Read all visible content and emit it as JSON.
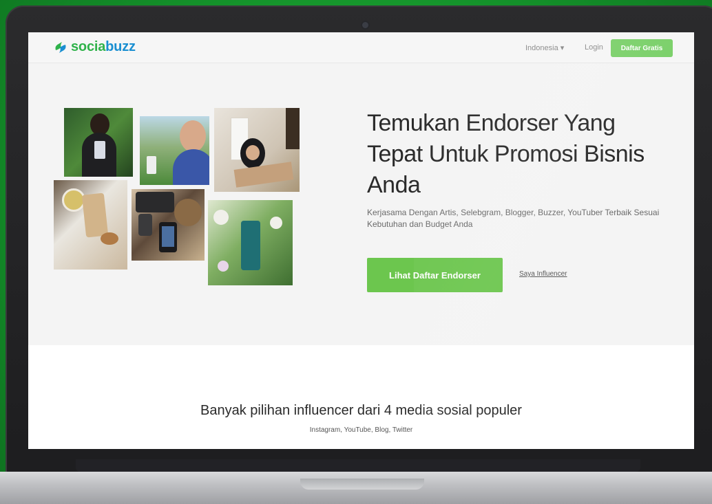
{
  "brand": {
    "part1": "socia",
    "part2": "buzz",
    "color_green": "#2fb24a",
    "color_blue": "#1a8fd1"
  },
  "nav": {
    "language": "Indonesia ▾",
    "login": "Login",
    "signup": "Daftar Gratis"
  },
  "hero": {
    "title": "Temukan Endorser Yang Tepat Untuk Promosi Bisnis Anda",
    "subtitle": "Kerjasama Dengan Artis, Selebgram, Blogger, Buzzer, YouTuber Terbaik Sesuai Kebutuhan dan Budget Anda",
    "cta": "Lihat Daftar Endorser",
    "secondary_link": "Saya Influencer",
    "accent_color": "#6cc64e"
  },
  "collage": {
    "photos": [
      "photo-woman-plant-wall",
      "photo-woman-phone-garden",
      "photo-hijab-woman-reading",
      "photo-phone-flatlay",
      "photo-camera-flatlay",
      "photo-product-flowers"
    ]
  },
  "section": {
    "title": "Banyak pilihan influencer dari 4 media sosial populer",
    "subtitle": "Instagram, YouTube, Blog, Twitter"
  }
}
